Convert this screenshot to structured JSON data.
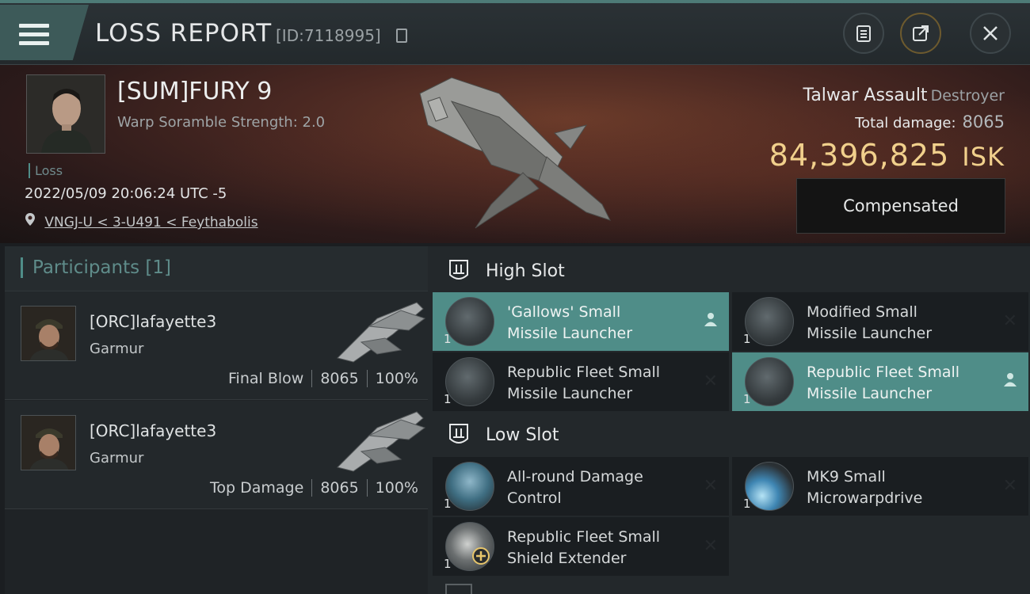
{
  "header": {
    "title": "LOSS REPORT",
    "report_id": "[ID:7118995]"
  },
  "victim": {
    "name": "[SUM]FURY 9",
    "warp_scramble": "Warp Soramble Strength: 2.0",
    "tag": "Loss",
    "timestamp": "2022/05/09 20:06:24 UTC -5",
    "location": "VNGJ-U < 3-U491 < Feythabolis",
    "ship_name": "Talwar Assault",
    "ship_class": "Destroyer",
    "total_damage_label": "Total damage:",
    "total_damage": "8065",
    "isk_value": "84,396,825",
    "isk_unit": "ISK",
    "compensation_label": "Compensated"
  },
  "participants": {
    "label": "Participants",
    "count": "[1]",
    "items": [
      {
        "name": "[ORC]lafayette3",
        "ship": "Garmur",
        "role": "Final Blow",
        "damage": "8065",
        "percent": "100%"
      },
      {
        "name": "[ORC]lafayette3",
        "ship": "Garmur",
        "role": "Top Damage",
        "damage": "8065",
        "percent": "100%"
      }
    ]
  },
  "fitting": {
    "high_slot": {
      "label": "High Slot",
      "modules": [
        {
          "line1": "'Gallows' Small",
          "line2": "Missile Launcher",
          "qty": "1",
          "active": true,
          "marker_icon": "person-icon"
        },
        {
          "line1": "Modified Small",
          "line2": "Missile Launcher",
          "qty": "1",
          "active": false,
          "marker_icon": "cross-icon"
        },
        {
          "line1": "Republic Fleet Small",
          "line2": "Missile Launcher",
          "qty": "1",
          "active": false,
          "marker_icon": "cross-icon"
        },
        {
          "line1": "Republic Fleet Small",
          "line2": "Missile Launcher",
          "qty": "1",
          "active": true,
          "marker_icon": "person-icon"
        }
      ]
    },
    "low_slot": {
      "label": "Low Slot",
      "modules": [
        {
          "line1": "All-round Damage",
          "line2": "Control",
          "qty": "1",
          "active": false,
          "marker_icon": "cross-icon"
        },
        {
          "line1": "MK9 Small",
          "line2": "Microwarpdrive",
          "qty": "1",
          "active": false,
          "marker_icon": "cross-icon"
        },
        {
          "line1": "Republic Fleet Small",
          "line2": "Shield Extender",
          "qty": "1",
          "active": false,
          "marker_icon": "cross-icon"
        }
      ]
    }
  },
  "colors": {
    "accent_teal": "#4f8d88",
    "isk_gold": "#f1d08c"
  }
}
